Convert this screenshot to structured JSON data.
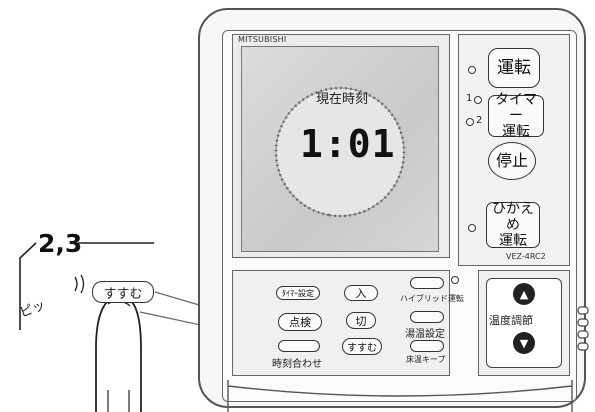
{
  "brand": "MITSUBISHI",
  "model": "VEZ-4RC2",
  "display": {
    "label": "現在時刻",
    "time": "1:01"
  },
  "right_panel": {
    "run_button": "運転",
    "timer_led_1": "1",
    "timer_led_2": "2",
    "timer_run_button_line1": "タイマー",
    "timer_run_button_line2": "運転",
    "stop_button": "停止",
    "eco_run_button_line1": "ひかえめ",
    "eco_run_button_line2": "運転"
  },
  "bottom_panel": {
    "timer_setting_button": "ﾀｲﾏｰ設定",
    "on_button": "入",
    "check_button": "点検",
    "off_button": "切",
    "advance_button": "すすむ",
    "clock_set_label": "時刻合わせ",
    "hybrid_label": "ハイブリッド運転",
    "hot_water_setting_label": "湯温設定",
    "floor_temp_keep_label": "床温キープ"
  },
  "temperature": {
    "label": "温度調節",
    "up_icon": "triangle-up-icon",
    "down_icon": "triangle-down-icon"
  },
  "callout": {
    "step_label": "2,3",
    "sound": "ピッ",
    "button_label": "すすむ"
  },
  "colors": {
    "outline": "#333333",
    "panel": "#f0f0f0",
    "lcd": "#d0d0d0"
  }
}
